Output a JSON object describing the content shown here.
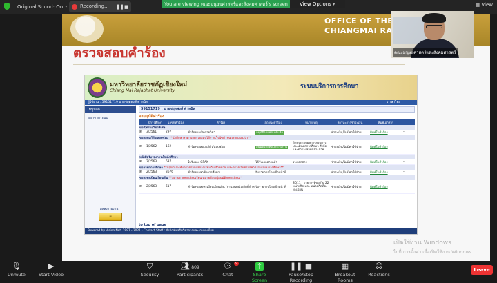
{
  "zoom_top": {
    "sound_label": "Original Sound: On",
    "recording_label": "Recording...",
    "viewing_banner": "You are viewing คณะมนุษยศาสตร์และสังคมศาสตร์'s screen",
    "view_options": "View Options",
    "view_label": "View"
  },
  "slide": {
    "office_line1": "OFFICE OF THE REGISTRAR",
    "office_line2": "CHIANGMAI RAJABHAT U",
    "title": "ตรวจสอบคำร้อง"
  },
  "webcam": {
    "name": "คณะมนุษยศาสตร์และสังคมศาสตร์"
  },
  "website": {
    "uni_th": "มหาวิทยาลัยราชภัฏเชียงใหม่",
    "uni_en": "Chiang Mai Rajabhat University",
    "system_title": "ระบบบริการการศึกษา",
    "bluebar_left": "ผู้ใช้งาน : 59151719 นายชยุตพงษ์ ดำหนิล",
    "bluebar_right": "ภาษาไทย",
    "menu_head": "เมนูหลัก",
    "menu_item": "ออกจากระบบ",
    "visits": "ผลลงรายงาน",
    "student_line": "59151719 : นายชยุตพงษ์ ดำหนิล",
    "section_title": "ผลอนุมัติคำร้อง",
    "columns": [
      "",
      "ปีการศึกษา",
      "เลขที่คำร้อง",
      "คำร้อง",
      "สถานะคำร้อง",
      "หมายเหตุ",
      "สถานะการชำระเงิน",
      "พิมพ์เอกสาร",
      ""
    ],
    "rows": [
      {
        "type": "sec",
        "text": "ขอเปิดรายวิชาพิเศษ",
        "note": ""
      },
      {
        "type": "data",
        "year": "3/2561",
        "no": "297",
        "req": "คำร้องขอเปิดรายวิชา",
        "status": "อนุมัติโดยคณบดีแล้ว",
        "remark": "",
        "pay": "ชำระเงิน/ไม่มีค่าใช้จ่าย",
        "print": "พิมพ์ใบคำร้อง",
        "dash": "--"
      },
      {
        "type": "sec",
        "text": "ขอสอบแก้ตัว/สอบซ่อม",
        "note": "**นักศึกษาสามารถตรวจสอบได้จากเว็บไซต์ reg.cmru.ac.th**"
      },
      {
        "type": "data",
        "year": "1/2562",
        "no": "162",
        "req": "คำร้องขอสอบแก้ตัว/สอบซ่อม",
        "status": "อนุมัติโดยคณะกรรมการ",
        "remark": "ติดประกอบผลการสอบการประเมินผลการศึกษา สังกัด และตารางสอบกลางภาค",
        "pay": "ชำระเงิน/ไม่มีค่าใช้จ่าย",
        "print": "พิมพ์ใบคำร้อง",
        "dash": "--"
      },
      {
        "type": "sec",
        "text": "หนังสือรับรองการเป็นนักศึกษา",
        "note": ""
      },
      {
        "type": "data",
        "year": "2/2563",
        "no": "637",
        "req": "ใบรับรอง GPAX",
        "status": "ได้รับเอกสารแล้ว",
        "remark": "รางเอกสาร",
        "pay": "ชำระเงิน/ไม่มีค่าใช้จ่าย",
        "print": "พิมพ์ใบคำร้อง",
        "dash": "--"
      },
      {
        "type": "sec",
        "text": "ขอลาพักการศึกษา",
        "note": "**กรุณาประทับตราตรวจผลการเรียนกับเจ้าหน้าที่ และตรวจเงินตรวจค่าธรรมเนียมการศึกษา**"
      },
      {
        "type": "data",
        "year": "2/2563",
        "no": "3676",
        "req": "คำร้องขอลาพักการศึกษา",
        "status": "รับรายการโดยเจ้าหน้าที่",
        "remark": "",
        "pay": "ชำระเงิน/ไม่มีค่าใช้จ่าย",
        "print": "พิมพ์ใบคำร้อง",
        "dash": "--"
      },
      {
        "type": "sec",
        "text": "ขอลงทะเบียนเรียนเกิน",
        "note": "**สถานะ ลงทะเบียนเรียน หมายถึงรอผู้อนุมัติลงทะเบียน**"
      },
      {
        "type": "data",
        "year": "2/2563",
        "no": "617",
        "req": "คำร้องขอลงทะเบียนเรียนเกิน (จำนวนหน่วยกิตที่กำหนดไว้)",
        "status": "รับรายการโดยเจ้าหน้าที่",
        "remark": "SO11 : รายการที่ขอเกิน 22 หน่วยกิต และ หน่วยกิตที่ลงทะเบียน",
        "pay": "ชำระเงิน/ไม่มีค่าใช้จ่าย",
        "print": "พิมพ์ใบคำร้อง",
        "dash": "--"
      }
    ],
    "top_of_page": "to top of page",
    "footer": "Powered by Vision Net, 1997 - 2021 · Contact Staff : สำนักส่งเสริมวิชาการและงานทะเบียน"
  },
  "watermark": {
    "line1": "เปิดใช้งาน Windows",
    "line2": "ไปที่ การตั้งค่า เพื่อเปิดใช้งาน Windows"
  },
  "toolbar": {
    "unmute": "Unmute",
    "start_video": "Start Video",
    "security": "Security",
    "participants": "Participants",
    "participants_count": "809",
    "chat": "Chat",
    "chat_badge": "9",
    "share_screen": "Share Screen",
    "pause_recording": "Pause/Stop Recording",
    "breakout": "Breakout Rooms",
    "reactions": "Reactions",
    "leave": "Leave"
  }
}
